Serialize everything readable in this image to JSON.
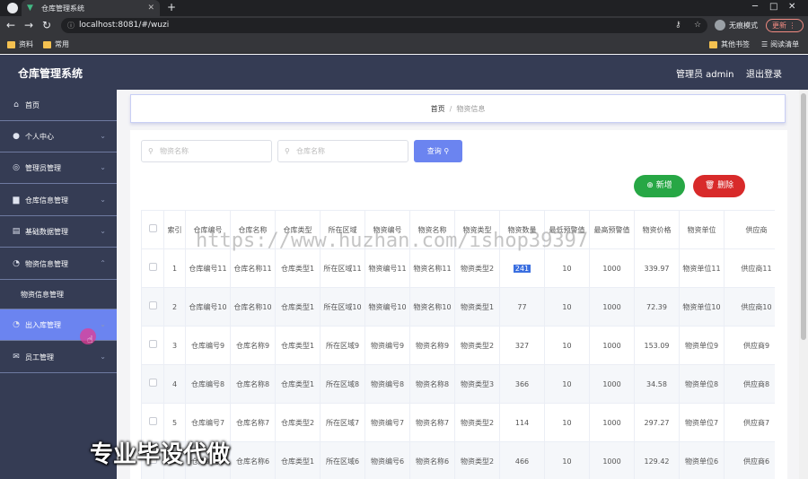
{
  "browser": {
    "tab_title": "仓库管理系统",
    "url": "localhost:8081/#/wuzi",
    "incognito_label": "无痕模式",
    "update_label": "更新",
    "bookmarks": [
      "资料",
      "常用"
    ],
    "bookmarks_right": [
      "其他书签",
      "阅读清单"
    ]
  },
  "header": {
    "title": "仓库管理系统",
    "admin_label": "管理员 admin",
    "logout_label": "退出登录"
  },
  "sidebar": {
    "items": [
      {
        "label": "首页"
      },
      {
        "label": "个人中心"
      },
      {
        "label": "管理员管理"
      },
      {
        "label": "仓库信息管理"
      },
      {
        "label": "基础数据管理"
      },
      {
        "label": "物资信息管理"
      },
      {
        "label": "物资信息管理"
      },
      {
        "label": "出入库管理"
      },
      {
        "label": "员工管理"
      }
    ]
  },
  "breadcrumb": {
    "home": "首页",
    "separator": "/",
    "current": "物资信息"
  },
  "search": {
    "material_placeholder": "物资名称",
    "warehouse_placeholder": "仓库名称",
    "query_label": "查询"
  },
  "actions": {
    "add_label": "新增",
    "delete_label": "删除"
  },
  "table": {
    "headers": [
      "索引",
      "仓库编号",
      "仓库名称",
      "仓库类型",
      "所在区域",
      "物资编号",
      "物资名称",
      "物资类型",
      "物资数量",
      "最低预警值",
      "最高预警值",
      "物资价格",
      "物资单位",
      "供应商"
    ],
    "rows": [
      [
        "1",
        "仓库编号11",
        "仓库名称11",
        "仓库类型1",
        "所在区域11",
        "物资编号11",
        "物资名称11",
        "物资类型2",
        "241",
        "10",
        "1000",
        "339.97",
        "物资单位11",
        "供应商11"
      ],
      [
        "2",
        "仓库编号10",
        "仓库名称10",
        "仓库类型1",
        "所在区域10",
        "物资编号10",
        "物资名称10",
        "物资类型1",
        "77",
        "10",
        "1000",
        "72.39",
        "物资单位10",
        "供应商10"
      ],
      [
        "3",
        "仓库编号9",
        "仓库名称9",
        "仓库类型1",
        "所在区域9",
        "物资编号9",
        "物资名称9",
        "物资类型2",
        "327",
        "10",
        "1000",
        "153.09",
        "物资单位9",
        "供应商9"
      ],
      [
        "4",
        "仓库编号8",
        "仓库名称8",
        "仓库类型1",
        "所在区域8",
        "物资编号8",
        "物资名称8",
        "物资类型3",
        "366",
        "10",
        "1000",
        "34.58",
        "物资单位8",
        "供应商8"
      ],
      [
        "5",
        "仓库编号7",
        "仓库名称7",
        "仓库类型2",
        "所在区域7",
        "物资编号7",
        "物资名称7",
        "物资类型2",
        "114",
        "10",
        "1000",
        "297.27",
        "物资单位7",
        "供应商7"
      ],
      [
        "6",
        "仓库编号6",
        "仓库名称6",
        "仓库类型1",
        "所在区域6",
        "物资编号6",
        "物资名称6",
        "物资类型2",
        "466",
        "10",
        "1000",
        "129.42",
        "物资单位6",
        "供应商6"
      ]
    ]
  },
  "watermark": {
    "url_text": "https://www.huzhan.com/ishop39397",
    "cn_text": "专业毕设代做"
  },
  "colors": {
    "header_bg": "#353c54",
    "sidebar_active": "#6b84f0",
    "query_btn": "#6b84f0",
    "add_btn": "#27a745",
    "delete_btn": "#d82a2a"
  }
}
